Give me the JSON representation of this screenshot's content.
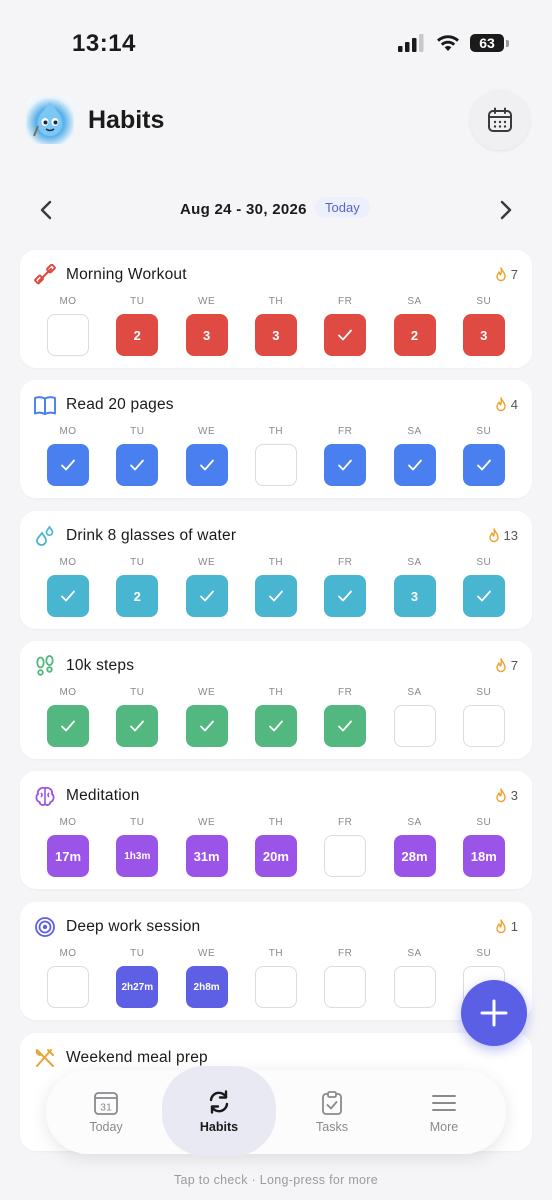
{
  "status": {
    "time": "13:14",
    "battery": "63"
  },
  "header": {
    "title": "Habits"
  },
  "week": {
    "range": "Aug 24 - 30, 2026",
    "today_label": "Today"
  },
  "habits": [
    {
      "name": "Morning Workout",
      "streak": "7",
      "color": "#df4a42",
      "icon": "dumbbell-icon",
      "days": [
        {
          "label": "MO",
          "state": "empty",
          "value": ""
        },
        {
          "label": "TU",
          "state": "count",
          "value": "2"
        },
        {
          "label": "WE",
          "state": "count",
          "value": "3"
        },
        {
          "label": "TH",
          "state": "count",
          "value": "3"
        },
        {
          "label": "FR",
          "state": "check",
          "value": ""
        },
        {
          "label": "SA",
          "state": "count",
          "value": "2"
        },
        {
          "label": "SU",
          "state": "count",
          "value": "3"
        }
      ]
    },
    {
      "name": "Read 20 pages",
      "streak": "4",
      "color": "#4a7ff0",
      "icon": "book-icon",
      "days": [
        {
          "label": "MO",
          "state": "check",
          "value": ""
        },
        {
          "label": "TU",
          "state": "check",
          "value": ""
        },
        {
          "label": "WE",
          "state": "check",
          "value": ""
        },
        {
          "label": "TH",
          "state": "empty",
          "value": ""
        },
        {
          "label": "FR",
          "state": "check",
          "value": ""
        },
        {
          "label": "SA",
          "state": "check",
          "value": ""
        },
        {
          "label": "SU",
          "state": "check",
          "value": ""
        }
      ]
    },
    {
      "name": "Drink 8 glasses of water",
      "streak": "13",
      "color": "#49b6d1",
      "icon": "water-drops-icon",
      "days": [
        {
          "label": "MO",
          "state": "check",
          "value": ""
        },
        {
          "label": "TU",
          "state": "count",
          "value": "2"
        },
        {
          "label": "WE",
          "state": "check",
          "value": ""
        },
        {
          "label": "TH",
          "state": "check",
          "value": ""
        },
        {
          "label": "FR",
          "state": "check",
          "value": ""
        },
        {
          "label": "SA",
          "state": "count",
          "value": "3"
        },
        {
          "label": "SU",
          "state": "check",
          "value": ""
        }
      ]
    },
    {
      "name": "10k steps",
      "streak": "7",
      "color": "#52b87f",
      "icon": "footsteps-icon",
      "days": [
        {
          "label": "MO",
          "state": "check",
          "value": ""
        },
        {
          "label": "TU",
          "state": "check",
          "value": ""
        },
        {
          "label": "WE",
          "state": "check",
          "value": ""
        },
        {
          "label": "TH",
          "state": "check",
          "value": ""
        },
        {
          "label": "FR",
          "state": "check",
          "value": ""
        },
        {
          "label": "SA",
          "state": "empty",
          "value": ""
        },
        {
          "label": "SU",
          "state": "empty",
          "value": ""
        }
      ]
    },
    {
      "name": "Meditation",
      "streak": "3",
      "color": "#9a54e8",
      "icon": "brain-icon",
      "days": [
        {
          "label": "MO",
          "state": "count",
          "value": "17m"
        },
        {
          "label": "TU",
          "state": "count",
          "value": "1h3m"
        },
        {
          "label": "WE",
          "state": "count",
          "value": "31m"
        },
        {
          "label": "TH",
          "state": "count",
          "value": "20m"
        },
        {
          "label": "FR",
          "state": "empty",
          "value": ""
        },
        {
          "label": "SA",
          "state": "count",
          "value": "28m"
        },
        {
          "label": "SU",
          "state": "count",
          "value": "18m"
        }
      ]
    },
    {
      "name": "Deep work session",
      "streak": "1",
      "color": "#5d5fe4",
      "icon": "target-icon",
      "days": [
        {
          "label": "MO",
          "state": "empty",
          "value": ""
        },
        {
          "label": "TU",
          "state": "count",
          "value": "2h27m"
        },
        {
          "label": "WE",
          "state": "count",
          "value": "2h8m"
        },
        {
          "label": "TH",
          "state": "empty",
          "value": ""
        },
        {
          "label": "FR",
          "state": "empty",
          "value": ""
        },
        {
          "label": "SA",
          "state": "empty",
          "value": ""
        },
        {
          "label": "SU",
          "state": "empty",
          "value": ""
        }
      ]
    },
    {
      "name": "Weekend meal prep",
      "streak": "",
      "color": "#e7a43a",
      "icon": "utensils-icon",
      "days": []
    }
  ],
  "tabs": [
    {
      "label": "Today",
      "icon": "calendar-31-icon",
      "badge": "31"
    },
    {
      "label": "Habits",
      "icon": "refresh-icon"
    },
    {
      "label": "Tasks",
      "icon": "clipboard-check-icon"
    },
    {
      "label": "More",
      "icon": "menu-icon"
    }
  ],
  "hint": "Tap to check · Long-press for more"
}
